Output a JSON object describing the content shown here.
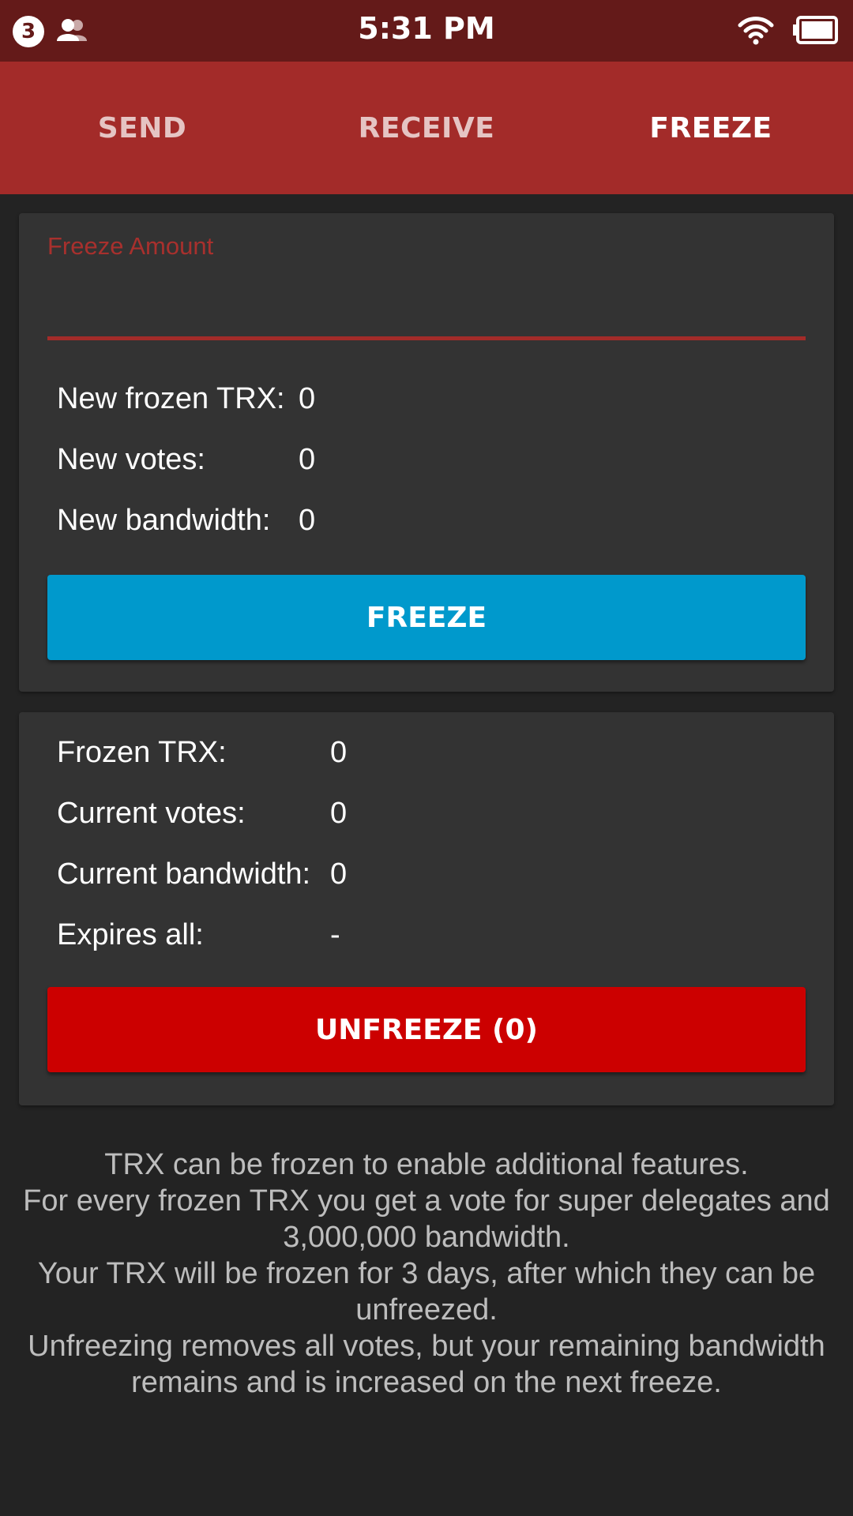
{
  "status_bar": {
    "notification_count": "3",
    "time": "5:31 PM",
    "icons": [
      "contacts-icon",
      "wifi-icon",
      "battery-icon"
    ]
  },
  "tabs": [
    {
      "label": "SEND",
      "active": false
    },
    {
      "label": "RECEIVE",
      "active": false
    },
    {
      "label": "FREEZE",
      "active": true
    }
  ],
  "freeze_card": {
    "amount_label": "Freeze Amount",
    "amount_value": "",
    "rows": [
      {
        "label": "New frozen TRX:",
        "value": "0"
      },
      {
        "label": "New votes:",
        "value": "0"
      },
      {
        "label": "New bandwidth:",
        "value": "0"
      }
    ],
    "button_label": "FREEZE"
  },
  "frozen_card": {
    "rows": [
      {
        "label": "Frozen TRX:",
        "value": "0"
      },
      {
        "label": "Current votes:",
        "value": "0"
      },
      {
        "label": "Current bandwidth:",
        "value": "0"
      },
      {
        "label": "Expires all:",
        "value": "-"
      }
    ],
    "button_label": "UNFREEZE (0)"
  },
  "info_text": [
    "TRX can be frozen to enable additional features.",
    "For every frozen TRX you get a vote for super delegates and 3,000,000 bandwidth.",
    "Your TRX will be frozen for 3 days, after which they can be unfreezed.",
    "Unfreezing removes all votes, but your remaining bandwidth remains and is increased on the next freeze."
  ],
  "colors": {
    "status_bar": "#641a19",
    "tab_bar": "#a32b29",
    "accent_red": "#a8302d",
    "freeze_button": "#0099cc",
    "unfreeze_button": "#cc0000",
    "background": "#232323",
    "card": "#333333"
  }
}
